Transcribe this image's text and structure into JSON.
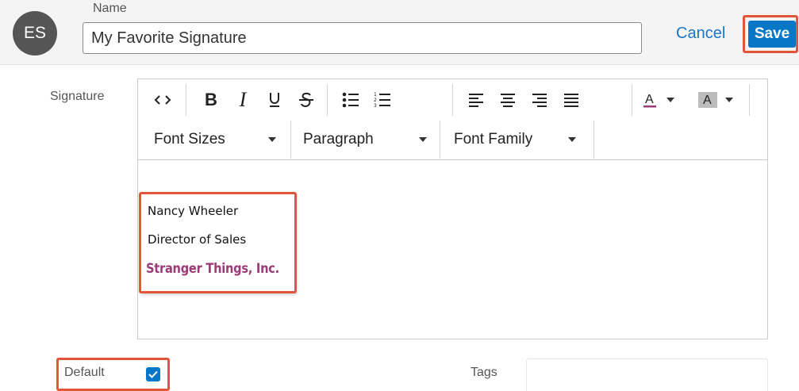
{
  "header": {
    "avatar_initials": "ES",
    "name_label": "Name",
    "name_value": "My Favorite Signature",
    "cancel_label": "Cancel",
    "save_label": "Save"
  },
  "form": {
    "signature_label": "Signature",
    "default_label": "Default",
    "default_checked": true,
    "tags_label": "Tags"
  },
  "toolbar": {
    "row1": [
      {
        "icon": "source-code-icon",
        "label": "Source code"
      },
      {
        "icon": "bold-icon",
        "label": "Bold"
      },
      {
        "icon": "italic-icon",
        "label": "Italic"
      },
      {
        "icon": "underline-icon",
        "label": "Underline"
      },
      {
        "icon": "strikethrough-icon",
        "label": "Strikethrough"
      },
      {
        "icon": "bullet-list-icon",
        "label": "Bullet list"
      },
      {
        "icon": "numbered-list-icon",
        "label": "Numbered list"
      },
      {
        "icon": "align-left-icon",
        "label": "Align left"
      },
      {
        "icon": "align-center-icon",
        "label": "Align center"
      },
      {
        "icon": "align-right-icon",
        "label": "Align right"
      },
      {
        "icon": "justify-icon",
        "label": "Justify"
      },
      {
        "icon": "text-color-icon",
        "label": "Text color"
      },
      {
        "icon": "background-color-icon",
        "label": "Background color"
      }
    ],
    "font_sizes": "Font Sizes",
    "paragraph": "Paragraph",
    "font_family": "Font Family"
  },
  "signature_content": {
    "name": "Nancy Wheeler",
    "title": "Director of Sales",
    "company": "Stranger Things, Inc."
  },
  "colors": {
    "accent": "#0676c7",
    "link": "#1a74c8",
    "highlight": "#e2553b",
    "company_text": "#9b3c78"
  }
}
